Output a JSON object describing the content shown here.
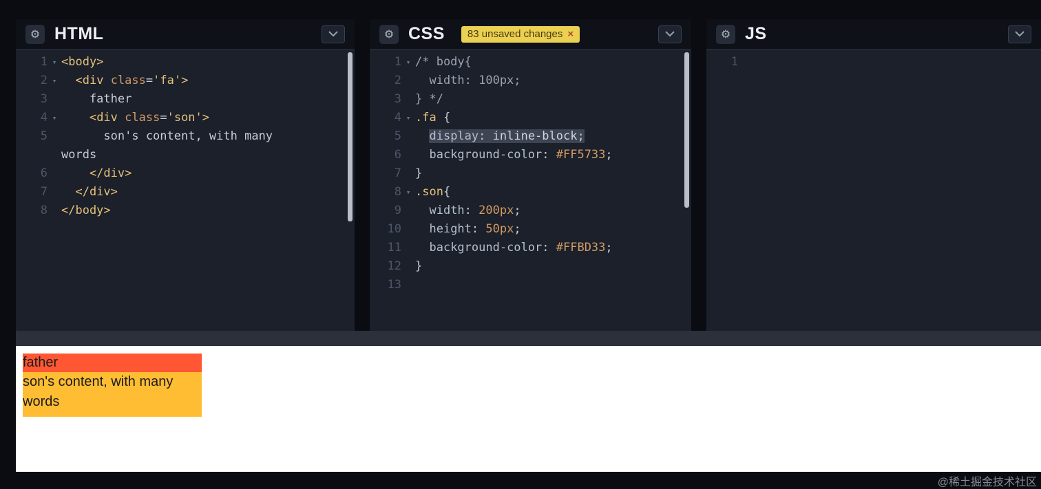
{
  "watermark": "@稀土掘金技术社区",
  "icons": {
    "gear": "⚙",
    "fold_arrow": "▾",
    "chevron": "chevron-down"
  },
  "preview": {
    "father_text": "father",
    "son_text": "son's content, with many words",
    "father_bg": "#FF5733",
    "son_bg": "#FFBD33"
  },
  "editors": [
    {
      "id": "html",
      "title": "HTML",
      "lines": [
        {
          "num": "1",
          "fold": true,
          "tokens": [
            [
              "tag",
              "<body>"
            ]
          ]
        },
        {
          "num": "2",
          "fold": true,
          "tokens": [
            [
              "plain",
              "  "
            ],
            [
              "tag",
              "<div"
            ],
            [
              "plain",
              " "
            ],
            [
              "attr",
              "class"
            ],
            [
              "punc",
              "="
            ],
            [
              "str",
              "'fa'"
            ],
            [
              "tag",
              ">"
            ]
          ]
        },
        {
          "num": "3",
          "tokens": [
            [
              "plain",
              "    father"
            ]
          ]
        },
        {
          "num": "4",
          "fold": true,
          "tokens": [
            [
              "plain",
              "    "
            ],
            [
              "tag",
              "<div"
            ],
            [
              "plain",
              " "
            ],
            [
              "attr",
              "class"
            ],
            [
              "punc",
              "="
            ],
            [
              "str",
              "'son'"
            ],
            [
              "tag",
              ">"
            ]
          ]
        },
        {
          "num": "5",
          "tokens": [
            [
              "plain",
              "      son's content, with many"
            ]
          ]
        },
        {
          "num": "",
          "tokens": [
            [
              "plain",
              "words"
            ]
          ]
        },
        {
          "num": "6",
          "tokens": [
            [
              "plain",
              "    "
            ],
            [
              "tag",
              "</div>"
            ]
          ]
        },
        {
          "num": "7",
          "tokens": [
            [
              "plain",
              "  "
            ],
            [
              "tag",
              "</div>"
            ]
          ]
        },
        {
          "num": "8",
          "tokens": [
            [
              "tag",
              "</body>"
            ]
          ]
        }
      ]
    },
    {
      "id": "css",
      "title": "CSS",
      "badge": {
        "text": "83 unsaved changes",
        "close": "×"
      },
      "lines": [
        {
          "num": "1",
          "fold": true,
          "tokens": [
            [
              "comment",
              "/* body{"
            ]
          ]
        },
        {
          "num": "2",
          "tokens": [
            [
              "comment",
              "  width: 100px;"
            ]
          ]
        },
        {
          "num": "3",
          "tokens": [
            [
              "comment",
              "} */"
            ]
          ]
        },
        {
          "num": "4",
          "fold": true,
          "tokens": [
            [
              "selector",
              ".fa"
            ],
            [
              "plain",
              " {"
            ]
          ]
        },
        {
          "num": "5",
          "tokens": [
            [
              "plain",
              "  "
            ],
            [
              "cursor",
              ""
            ],
            [
              "prop",
              "display",
              "hl"
            ],
            [
              "punc",
              ":",
              "hl"
            ],
            [
              "plain",
              " ",
              "hl"
            ],
            [
              "val",
              "inline-block",
              "hl"
            ],
            [
              "punc",
              ";",
              "hl"
            ]
          ]
        },
        {
          "num": "6",
          "tokens": [
            [
              "plain",
              "  "
            ],
            [
              "prop",
              "background-color"
            ],
            [
              "punc",
              ":"
            ],
            [
              "plain",
              " "
            ],
            [
              "num",
              "#FF5733"
            ],
            [
              "punc",
              ";"
            ]
          ]
        },
        {
          "num": "7",
          "tokens": [
            [
              "plain",
              "}"
            ]
          ]
        },
        {
          "num": "8",
          "fold": true,
          "tokens": [
            [
              "selector",
              ".son"
            ],
            [
              "plain",
              "{"
            ]
          ]
        },
        {
          "num": "9",
          "tokens": [
            [
              "plain",
              "  "
            ],
            [
              "prop",
              "width"
            ],
            [
              "punc",
              ":"
            ],
            [
              "plain",
              " "
            ],
            [
              "num",
              "200px"
            ],
            [
              "punc",
              ";"
            ]
          ]
        },
        {
          "num": "10",
          "tokens": [
            [
              "plain",
              "  "
            ],
            [
              "prop",
              "height"
            ],
            [
              "punc",
              ":"
            ],
            [
              "plain",
              " "
            ],
            [
              "num",
              "50px"
            ],
            [
              "punc",
              ";"
            ]
          ]
        },
        {
          "num": "11",
          "tokens": [
            [
              "plain",
              "  "
            ],
            [
              "prop",
              "background-color"
            ],
            [
              "punc",
              ":"
            ],
            [
              "plain",
              " "
            ],
            [
              "num",
              "#FFBD33"
            ],
            [
              "punc",
              ";"
            ]
          ]
        },
        {
          "num": "12",
          "tokens": [
            [
              "plain",
              "}"
            ]
          ]
        },
        {
          "num": "13",
          "tokens": []
        }
      ]
    },
    {
      "id": "js",
      "title": "JS",
      "lines": [
        {
          "num": "1",
          "tokens": []
        }
      ]
    }
  ]
}
